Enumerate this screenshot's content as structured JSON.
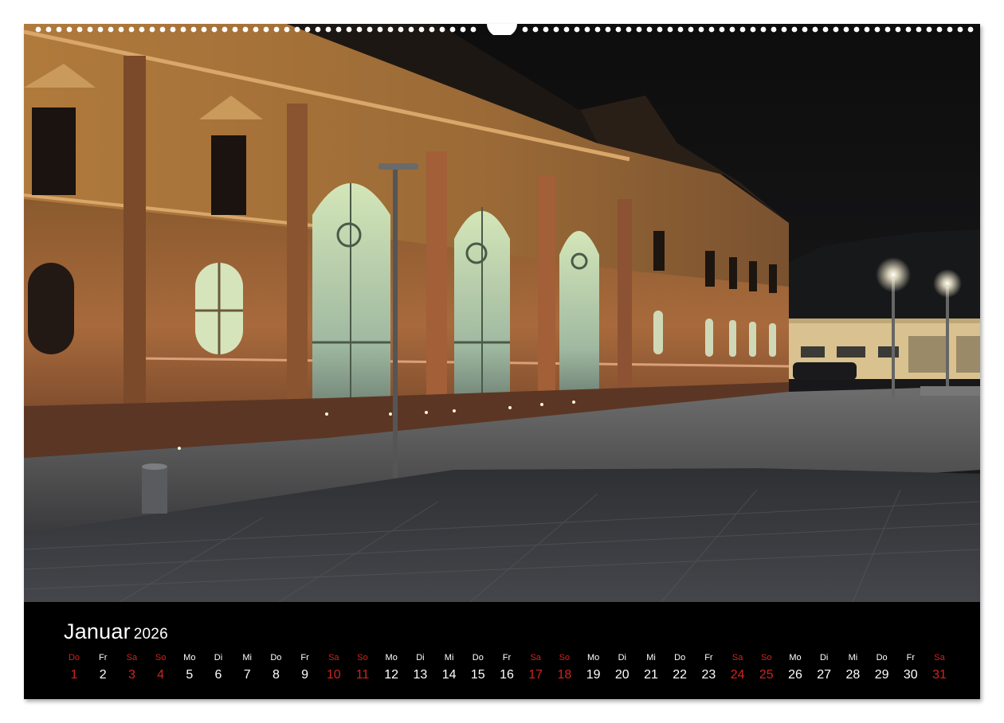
{
  "photo": {
    "description_icon": "illuminated-building-photo",
    "colors": {
      "sky": "#141414",
      "facade": "#c98a52",
      "window_glow": "#cfe2c0"
    }
  },
  "calendar": {
    "month": "Januar",
    "year": "2026",
    "weekend_color": "#d0241f",
    "days": [
      {
        "wd": "Do",
        "num": "1",
        "red": true
      },
      {
        "wd": "Fr",
        "num": "2",
        "red": false
      },
      {
        "wd": "Sa",
        "num": "3",
        "red": true
      },
      {
        "wd": "So",
        "num": "4",
        "red": true
      },
      {
        "wd": "Mo",
        "num": "5",
        "red": false
      },
      {
        "wd": "Di",
        "num": "6",
        "red": false
      },
      {
        "wd": "Mi",
        "num": "7",
        "red": false
      },
      {
        "wd": "Do",
        "num": "8",
        "red": false
      },
      {
        "wd": "Fr",
        "num": "9",
        "red": false
      },
      {
        "wd": "Sa",
        "num": "10",
        "red": true
      },
      {
        "wd": "So",
        "num": "11",
        "red": true
      },
      {
        "wd": "Mo",
        "num": "12",
        "red": false
      },
      {
        "wd": "Di",
        "num": "13",
        "red": false
      },
      {
        "wd": "Mi",
        "num": "14",
        "red": false
      },
      {
        "wd": "Do",
        "num": "15",
        "red": false
      },
      {
        "wd": "Fr",
        "num": "16",
        "red": false
      },
      {
        "wd": "Sa",
        "num": "17",
        "red": true
      },
      {
        "wd": "So",
        "num": "18",
        "red": true
      },
      {
        "wd": "Mo",
        "num": "19",
        "red": false
      },
      {
        "wd": "Di",
        "num": "20",
        "red": false
      },
      {
        "wd": "Mi",
        "num": "21",
        "red": false
      },
      {
        "wd": "Do",
        "num": "22",
        "red": false
      },
      {
        "wd": "Fr",
        "num": "23",
        "red": false
      },
      {
        "wd": "Sa",
        "num": "24",
        "red": true
      },
      {
        "wd": "So",
        "num": "25",
        "red": true
      },
      {
        "wd": "Mo",
        "num": "26",
        "red": false
      },
      {
        "wd": "Di",
        "num": "27",
        "red": false
      },
      {
        "wd": "Mi",
        "num": "28",
        "red": false
      },
      {
        "wd": "Do",
        "num": "29",
        "red": false
      },
      {
        "wd": "Fr",
        "num": "30",
        "red": false
      },
      {
        "wd": "Sa",
        "num": "31",
        "red": true
      }
    ]
  }
}
